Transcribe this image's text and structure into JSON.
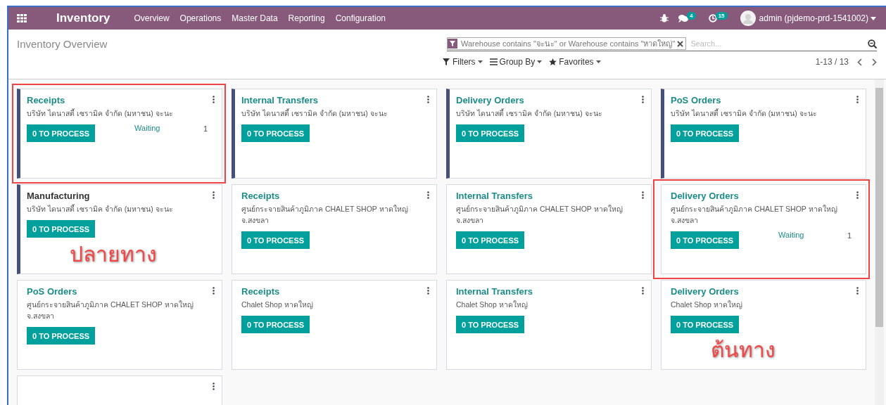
{
  "navbar": {
    "app_title": "Inventory",
    "menu": [
      "Overview",
      "Operations",
      "Master Data",
      "Reporting",
      "Configuration"
    ],
    "messages_count": "4",
    "activities_count": "15",
    "user": "admin (pjdemo-prd-1541002)"
  },
  "control_panel": {
    "breadcrumb": "Inventory Overview",
    "facet": "Warehouse contains \"จะนะ\" or Warehouse contains \"หาดใหญ่\"",
    "search_placeholder": "Search...",
    "filters": "Filters",
    "group_by": "Group By",
    "favorites": "Favorites",
    "pager": "1-13 / 13"
  },
  "cards": [
    {
      "title": "Receipts",
      "subtitle": "บริษัท ไดนาสตี้ เซรามิค จำกัด (มหาชน) จะนะ",
      "button": "0 TO PROCESS",
      "title_link": true,
      "color": "#44507a",
      "waiting": {
        "label": "Waiting",
        "count": "1"
      },
      "marked": true
    },
    {
      "title": "Internal Transfers",
      "subtitle": "บริษัท ไดนาสตี้ เซรามิค จำกัด (มหาชน) จะนะ",
      "button": "0 TO PROCESS",
      "title_link": true,
      "color": "#44507a",
      "marked": false
    },
    {
      "title": "Delivery Orders",
      "subtitle": "บริษัท ไดนาสตี้ เซรามิค จำกัด (มหาชน) จะนะ",
      "button": "0 TO PROCESS",
      "title_link": true,
      "color": "#44507a",
      "marked": false
    },
    {
      "title": "PoS Orders",
      "subtitle": "บริษัท ไดนาสตี้ เซรามิค จำกัด (มหาชน) จะนะ",
      "button": "0 TO PROCESS",
      "title_link": true,
      "color": "#44507a",
      "marked": false
    },
    {
      "title": "Manufacturing",
      "subtitle": "บริษัท ไดนาสตี้ เซรามิค จำกัด (มหาชน) จะนะ",
      "button": "0 TO PROCESS",
      "title_link": false,
      "color": "#44507a",
      "marked": false,
      "note": "ปลายทาง"
    },
    {
      "title": "Receipts",
      "subtitle": "ศูนย์กระจายสินค้าภูมิภาค CHALET SHOP หาดใหญ่ จ.สงขลา",
      "button": "0 TO PROCESS",
      "title_link": true,
      "marked": false
    },
    {
      "title": "Internal Transfers",
      "subtitle": "ศูนย์กระจายสินค้าภูมิภาค CHALET SHOP หาดใหญ่ จ.สงขลา",
      "button": "0 TO PROCESS",
      "title_link": true,
      "marked": false
    },
    {
      "title": "Delivery Orders",
      "subtitle": "ศูนย์กระจายสินค้าภูมิภาค CHALET SHOP หาดใหญ่ จ.สงขลา",
      "button": "0 TO PROCESS",
      "title_link": true,
      "waiting": {
        "label": "Waiting",
        "count": "1"
      },
      "marked": true
    },
    {
      "title": "PoS Orders",
      "subtitle": "ศูนย์กระจายสินค้าภูมิภาค CHALET SHOP หาดใหญ่ จ.สงขลา",
      "button": "0 TO PROCESS",
      "title_link": true,
      "marked": false
    },
    {
      "title": "Receipts",
      "subtitle": "Chalet Shop หาดใหญ่",
      "button": "0 TO PROCESS",
      "title_link": true,
      "marked": false
    },
    {
      "title": "Internal Transfers",
      "subtitle": "Chalet Shop หาดใหญ่",
      "button": "0 TO PROCESS",
      "title_link": true,
      "marked": false
    },
    {
      "title": "Delivery Orders",
      "subtitle": "Chalet Shop หาดใหญ่",
      "button": "0 TO PROCESS",
      "title_link": true,
      "marked": false,
      "note": "ต้นทาง"
    },
    {
      "marked": false
    }
  ]
}
